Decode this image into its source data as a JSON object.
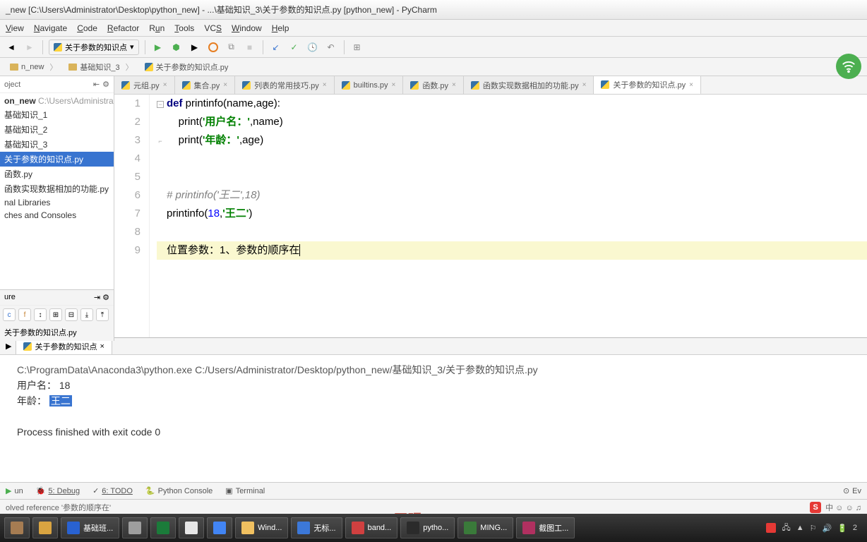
{
  "window": {
    "title": "_new [C:\\Users\\Administrator\\Desktop\\python_new] - ...\\基础知识_3\\关于参数的知识点.py [python_new] - PyCharm"
  },
  "menu": [
    "View",
    "Navigate",
    "Code",
    "Refactor",
    "Run",
    "Tools",
    "VCS",
    "Window",
    "Help"
  ],
  "run_config": "关于参数的知识点",
  "breadcrumb": [
    "n_new",
    "基础知识_3",
    "关于参数的知识点.py"
  ],
  "project": {
    "header": "oject",
    "root_label": "on_new",
    "root_path": "C:\\Users\\Administrato...",
    "items": [
      "基础知识_1",
      "基础知识_2",
      "基础知识_3",
      "关于参数的知识点.py",
      "函数.py",
      "函数实现数据相加的功能.py"
    ],
    "sel_index": 3,
    "ext": [
      "nal Libraries",
      "ches and Consoles"
    ]
  },
  "structure": {
    "title": "ure",
    "file": "关于参数的知识点.py"
  },
  "tabs": [
    {
      "label": "元组.py"
    },
    {
      "label": "集合.py"
    },
    {
      "label": "列表的常用技巧.py"
    },
    {
      "label": "builtins.py"
    },
    {
      "label": "函数.py"
    },
    {
      "label": "函数实现数据相加的功能.py"
    },
    {
      "label": "关于参数的知识点.py",
      "active": true
    }
  ],
  "code": {
    "lines": [
      {
        "n": 1,
        "html": "<span class='kw'>def</span> <span class='fn'>printinfo</span>(name,age):"
      },
      {
        "n": 2,
        "html": "    print(<span class='str'>'用户名：'</span>,name)"
      },
      {
        "n": 3,
        "html": "    print(<span class='str'>'年龄：'</span>,age)"
      },
      {
        "n": 4,
        "html": ""
      },
      {
        "n": 5,
        "html": ""
      },
      {
        "n": 6,
        "html": "<span class='cmt'># printinfo('王二',18)</span>"
      },
      {
        "n": 7,
        "html": "printinfo(<span style='color:#0000ff'>18</span>,<span class='str'>'王二'</span>)"
      },
      {
        "n": 8,
        "html": ""
      },
      {
        "n": 9,
        "html": "位置参数：1、参数的顺序在<span class='cursor'></span>",
        "hl": true
      }
    ]
  },
  "run_panel": {
    "tab": "关于参数的知识点",
    "cmd": "C:\\ProgramData\\Anaconda3\\python.exe C:/Users/Administrator/Desktop/python_new/基础知识_3/关于参数的知识点.py",
    "out1_a": "用户名：",
    "out1_b": " 18",
    "out2_a": "年龄：",
    "out2_b": "王二",
    "exit": "Process finished with exit code 0"
  },
  "bottom_tabs": {
    "run": "un",
    "debug": "5: Debug",
    "todo": "6: TODO",
    "pyconsole": "Python Console",
    "terminal": "Terminal",
    "events": "Ev"
  },
  "status": {
    "msg": "olved reference '参数的顺序在'",
    "ime": "中 ☺ ☺ ♫"
  },
  "taskbar": {
    "items": [
      {
        "label": "",
        "color": "#a67c52"
      },
      {
        "label": "",
        "color": "#d9a441"
      },
      {
        "label": "基础班...",
        "color": "#2962d1"
      },
      {
        "label": "",
        "color": "#9e9e9e"
      },
      {
        "label": "",
        "color": "#1b7b3a"
      },
      {
        "label": "",
        "color": "#e6e6e6"
      },
      {
        "label": "",
        "color": "#4285f4"
      },
      {
        "label": "Wind...",
        "color": "#f0c060"
      },
      {
        "label": "无标...",
        "color": "#3c78d8"
      },
      {
        "label": "band...",
        "color": "#d04040"
      },
      {
        "label": "pytho...",
        "color": "#2b2b2b"
      },
      {
        "label": "MING...",
        "color": "#3a7a3a"
      },
      {
        "label": "截图工...",
        "color": "#b03060"
      }
    ],
    "tray_time": "2"
  }
}
